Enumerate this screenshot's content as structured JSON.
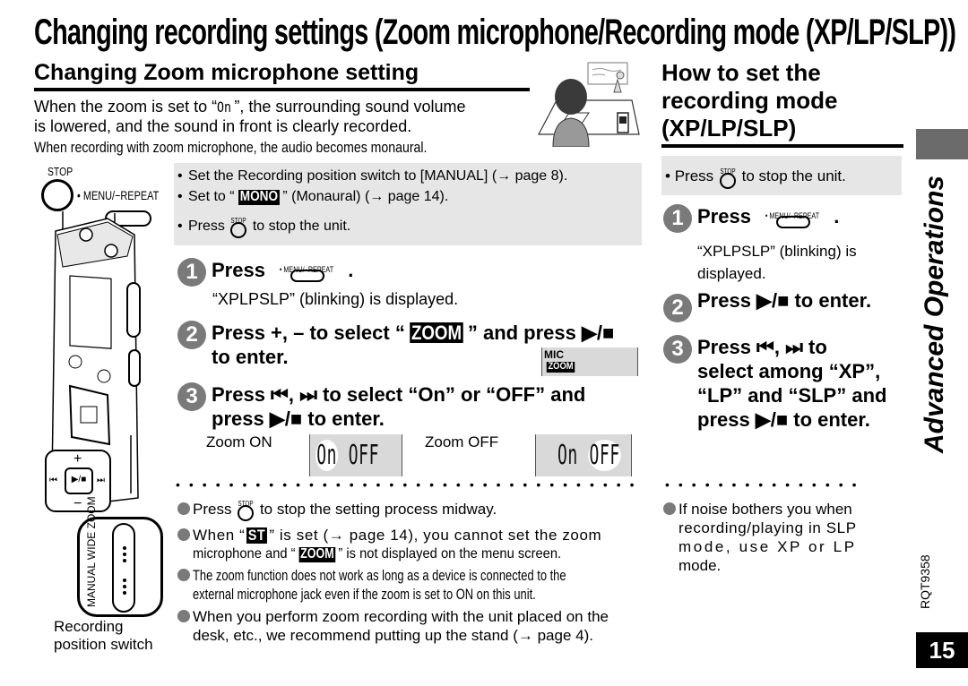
{
  "page": {
    "title": "Changing recording settings (Zoom microphone/Recording mode (XP/LP/SLP))",
    "section_tab_label": "Advanced Operations",
    "doc_code": "RQT9358",
    "page_number": "15",
    "colors": {
      "grey_box": "#e6e6e6",
      "step_circle": "#7a7a7a",
      "side_tab": "#6b6b6b"
    }
  },
  "device_illustration": {
    "stop_label": "STOP",
    "menu_label": "• MENU/−REPEAT",
    "plus": "+",
    "minus": "−",
    "switch_labels": [
      "MANUAL",
      "WIDE",
      "ZOOM"
    ],
    "caption_line1": "Recording",
    "caption_line2": "position switch"
  },
  "zoom_section": {
    "heading": "Changing Zoom microphone setting",
    "intro_line1_a": "When the zoom is set to “",
    "intro_on_glyph": "On",
    "intro_line1_b": "”, the surrounding sound volume",
    "intro_line2": "is lowered, and the sound in front is clearly recorded.",
    "intro_line3": "When recording with zoom microphone, the audio becomes monaural.",
    "prep": {
      "b1": "Set the Recording position switch to [MANUAL] (→ page 8).",
      "b2_a": "Set to “",
      "b2_badge": "MONO",
      "b2_b": "” (Monaural) (→ page 14).",
      "b3_a": "Press",
      "b3_b": "to stop the unit."
    },
    "steps": [
      {
        "num": "1",
        "text_a": "Press",
        "button": "• MENU/−REPEAT",
        "text_b": ".",
        "sub": "“XPLPSLP” (blinking) is displayed."
      },
      {
        "num": "2",
        "text_a": "Press +, – to select “",
        "badge": "ZOOM",
        "text_b": "” and press ▶/■",
        "text_c": "to enter."
      },
      {
        "num": "3",
        "text_a": "Press ⏮, ⏭ to select “On” or “OFF” and",
        "text_b": "press ▶/■ to enter."
      }
    ],
    "lcd_menu": {
      "line1": "MIC",
      "line2": "ZOOM"
    },
    "zoom_on": {
      "label": "Zoom ON",
      "seg1": "On",
      "seg2": "OFF"
    },
    "zoom_off": {
      "label": "Zoom OFF",
      "seg1": "On",
      "seg2": "OFF"
    },
    "notes": [
      {
        "a": "Press",
        "b": "to stop the setting process midway."
      },
      {
        "a": "When “",
        "badge": "ST",
        "b": "” is set (→ page 14), you cannot set the zoom",
        "c": "microphone and “",
        "badge2": "ZOOM",
        "d": "” is not displayed on the menu screen."
      },
      {
        "a": "The zoom function does not work as long as a device is connected to the",
        "b": "external microphone jack even if the zoom is set to ON on this unit."
      },
      {
        "a": "When you perform zoom recording with the unit placed on the",
        "b": "desk, etc., we recommend putting up the stand (→ page 4)."
      }
    ]
  },
  "mode_section": {
    "heading_line1": "How to set the",
    "heading_line2": "recording mode",
    "heading_line3": "(XP/LP/SLP)",
    "prep": {
      "a": "Press",
      "b": "to stop the unit."
    },
    "steps": [
      {
        "num": "1",
        "text_a": "Press",
        "button": "• MENU/−REPEAT",
        "text_b": ".",
        "sub1": "“XPLPSLP” (blinking) is",
        "sub2": "displayed."
      },
      {
        "num": "2",
        "text": "Press ▶/■ to enter."
      },
      {
        "num": "3",
        "line1": "Press ⏮, ⏭ to",
        "line2": "select among “XP”,",
        "line3": "“LP” and “SLP” and",
        "line4": "press ▶/■ to enter."
      }
    ],
    "note_line1": "If noise bothers you when",
    "note_line2": "recording/playing in SLP",
    "note_line3": "mode, use XP or LP",
    "note_line4": "mode."
  },
  "stop_small_label": "STOP"
}
